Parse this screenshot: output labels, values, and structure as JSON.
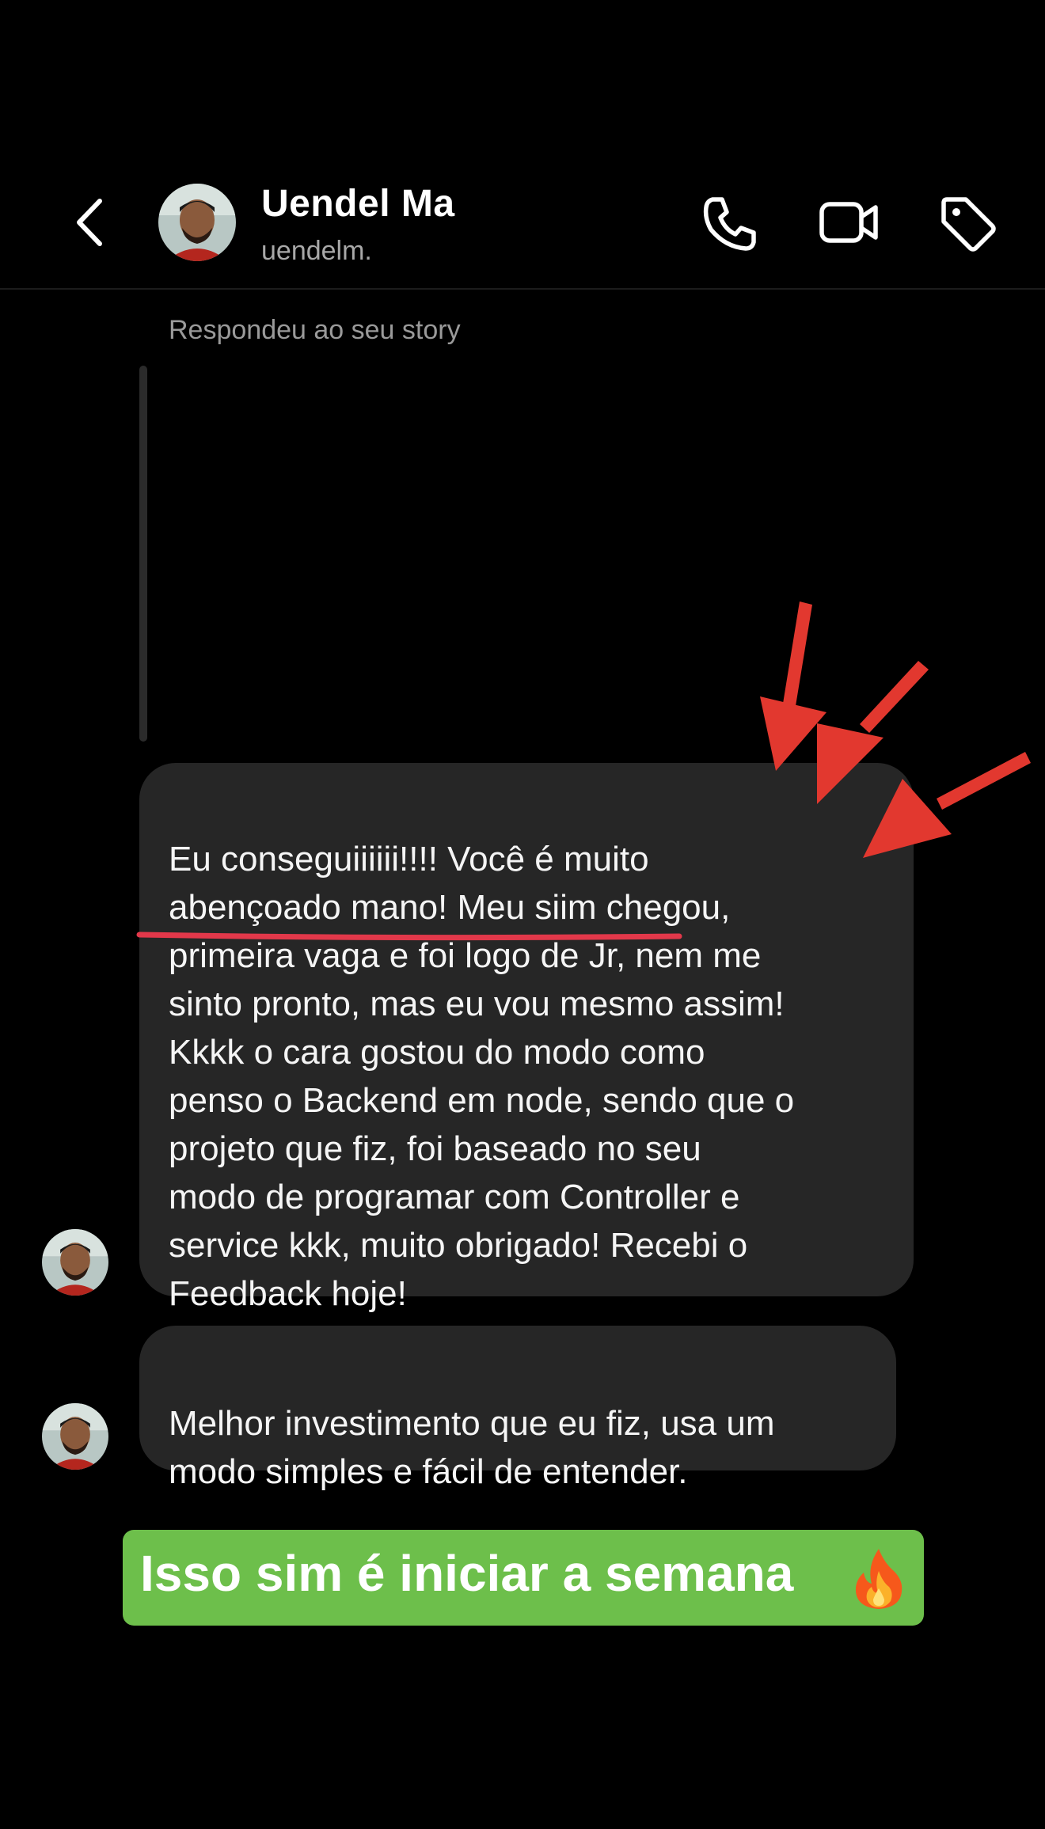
{
  "header": {
    "title": "Uendel Ma",
    "subtitle": "uendelm.",
    "icons": [
      "chevron-left-icon",
      "phone-icon",
      "video-camera-icon",
      "tag-icon"
    ]
  },
  "thread": {
    "replied_label": "Respondeu ao seu story",
    "messages": [
      {
        "text": "Eu conseguiiiiii!!!! Você é muito\nabençoado mano! Meu siim chegou,\nprimeira vaga e foi logo de Jr, nem me\nsinto pronto, mas eu vou mesmo assim!\nKkkk o cara gostou do modo como\npenso o Backend em node, sendo que o\nprojeto que fiz, foi baseado no seu\nmodo de programar com Controller e\nservice kkk, muito obrigado! Recebi o\nFeedback hoje!"
      },
      {
        "text": "Melhor investimento que eu fiz, usa um\nmodo simples e fácil de entender."
      }
    ]
  },
  "banner": {
    "text": "Isso sim é iniciar a semana",
    "icon": "fire-icon"
  },
  "colors": {
    "bubble": "#262626",
    "annotation_red": "#e2382f",
    "banner_green": "#6dbf4b"
  }
}
